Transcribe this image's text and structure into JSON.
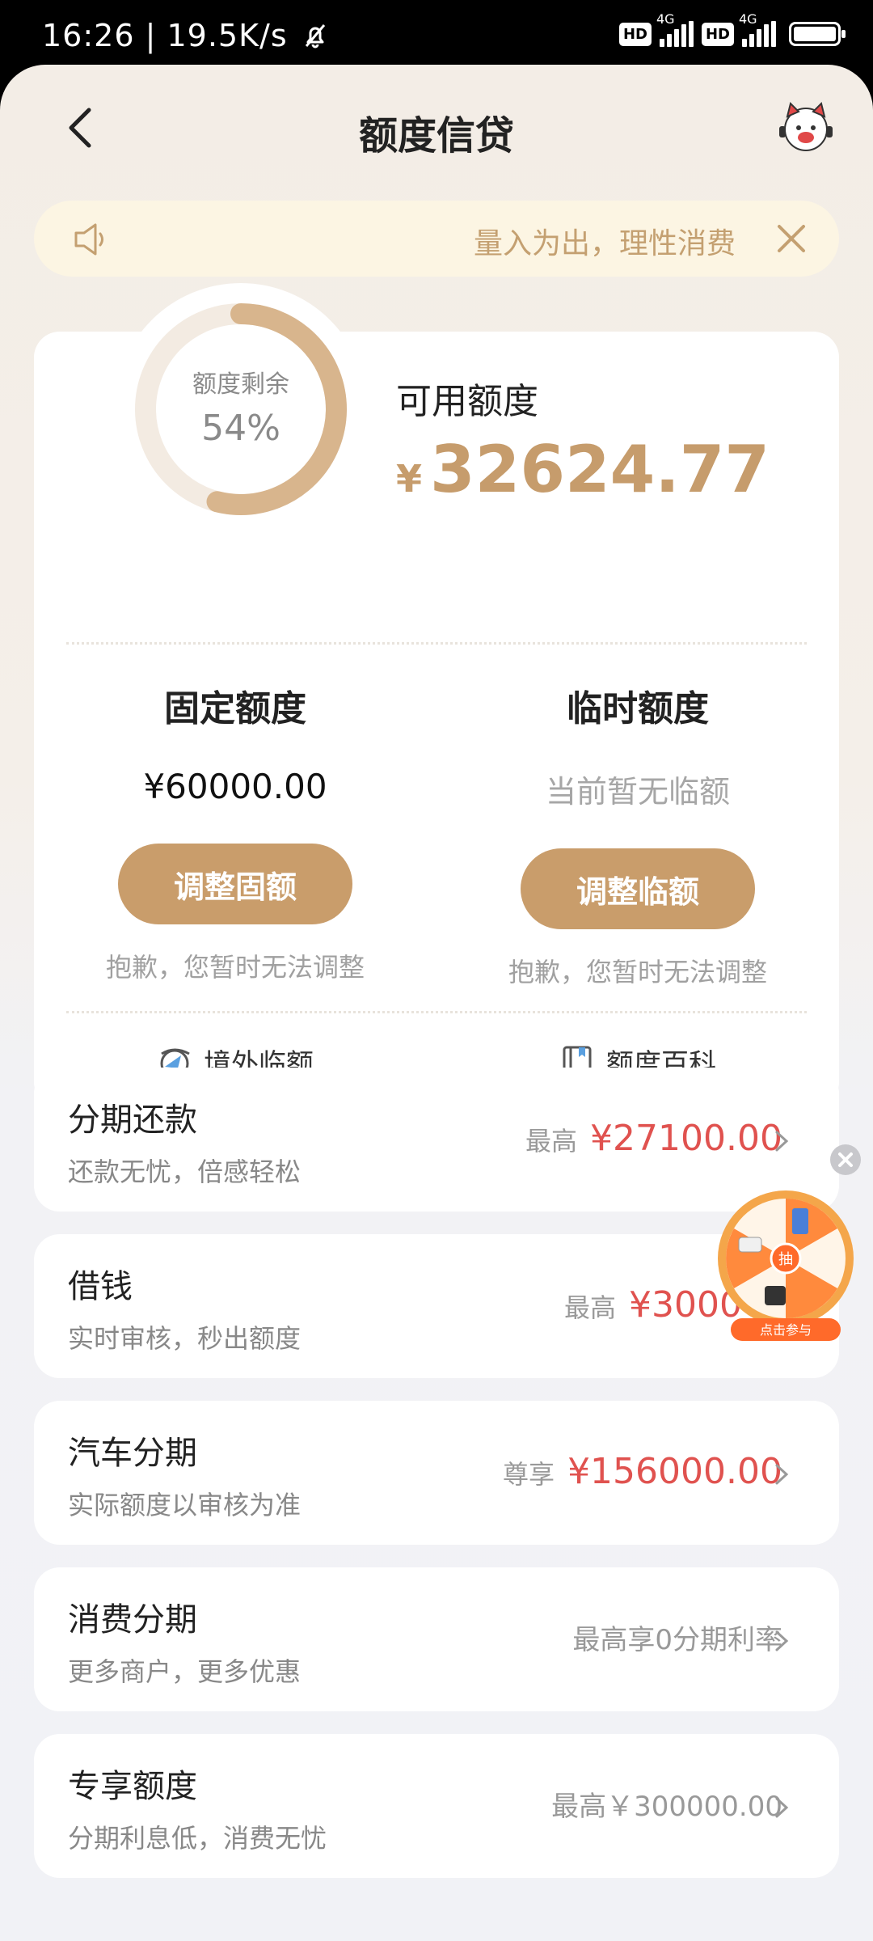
{
  "status_bar": {
    "time": "16:26",
    "speed": "19.5K/s",
    "net1": "4G",
    "net2": "4G",
    "hd": "HD"
  },
  "header": {
    "title": "额度信贷"
  },
  "notice": {
    "text": "量入为出，理性消费"
  },
  "credit": {
    "ring_label": "额度剩余",
    "ring_percent": "54%",
    "remaining_fraction": 0.54,
    "available_label": "可用额度",
    "currency": "¥",
    "available_amount": "32624.77",
    "fixed": {
      "title": "固定额度",
      "value": "¥60000.00",
      "button": "调整固额",
      "note": "抱歉，您暂时无法调整"
    },
    "temporary": {
      "title": "临时额度",
      "value": "当前暂无临额",
      "button": "调整临额",
      "note": "抱歉，您暂时无法调整"
    },
    "links": {
      "overseas": "境外临额",
      "encyclopedia": "额度百科"
    }
  },
  "services": [
    {
      "title": "分期还款",
      "subtitle": "还款无忧，倍感轻松",
      "prefix": "最高",
      "amount": "¥27100.00"
    },
    {
      "title": "借钱",
      "subtitle": "实时审核，秒出额度",
      "prefix": "最高",
      "amount": "¥3000"
    },
    {
      "title": "汽车分期",
      "subtitle": "实际额度以审核为准",
      "prefix": "尊享",
      "amount": "¥156000.00"
    },
    {
      "title": "消费分期",
      "subtitle": "更多商户，更多优惠",
      "info": "最高享0分期利率"
    },
    {
      "title": "专享额度",
      "subtitle": "分期利息低，消费无忧",
      "info": "最高￥300000.00"
    }
  ],
  "floating": {
    "center_label": "抽",
    "caption": "点击参与"
  },
  "colors": {
    "accent": "#c99d6b",
    "amount_red": "#e0524f",
    "notice_bg": "#fcf5e3"
  }
}
